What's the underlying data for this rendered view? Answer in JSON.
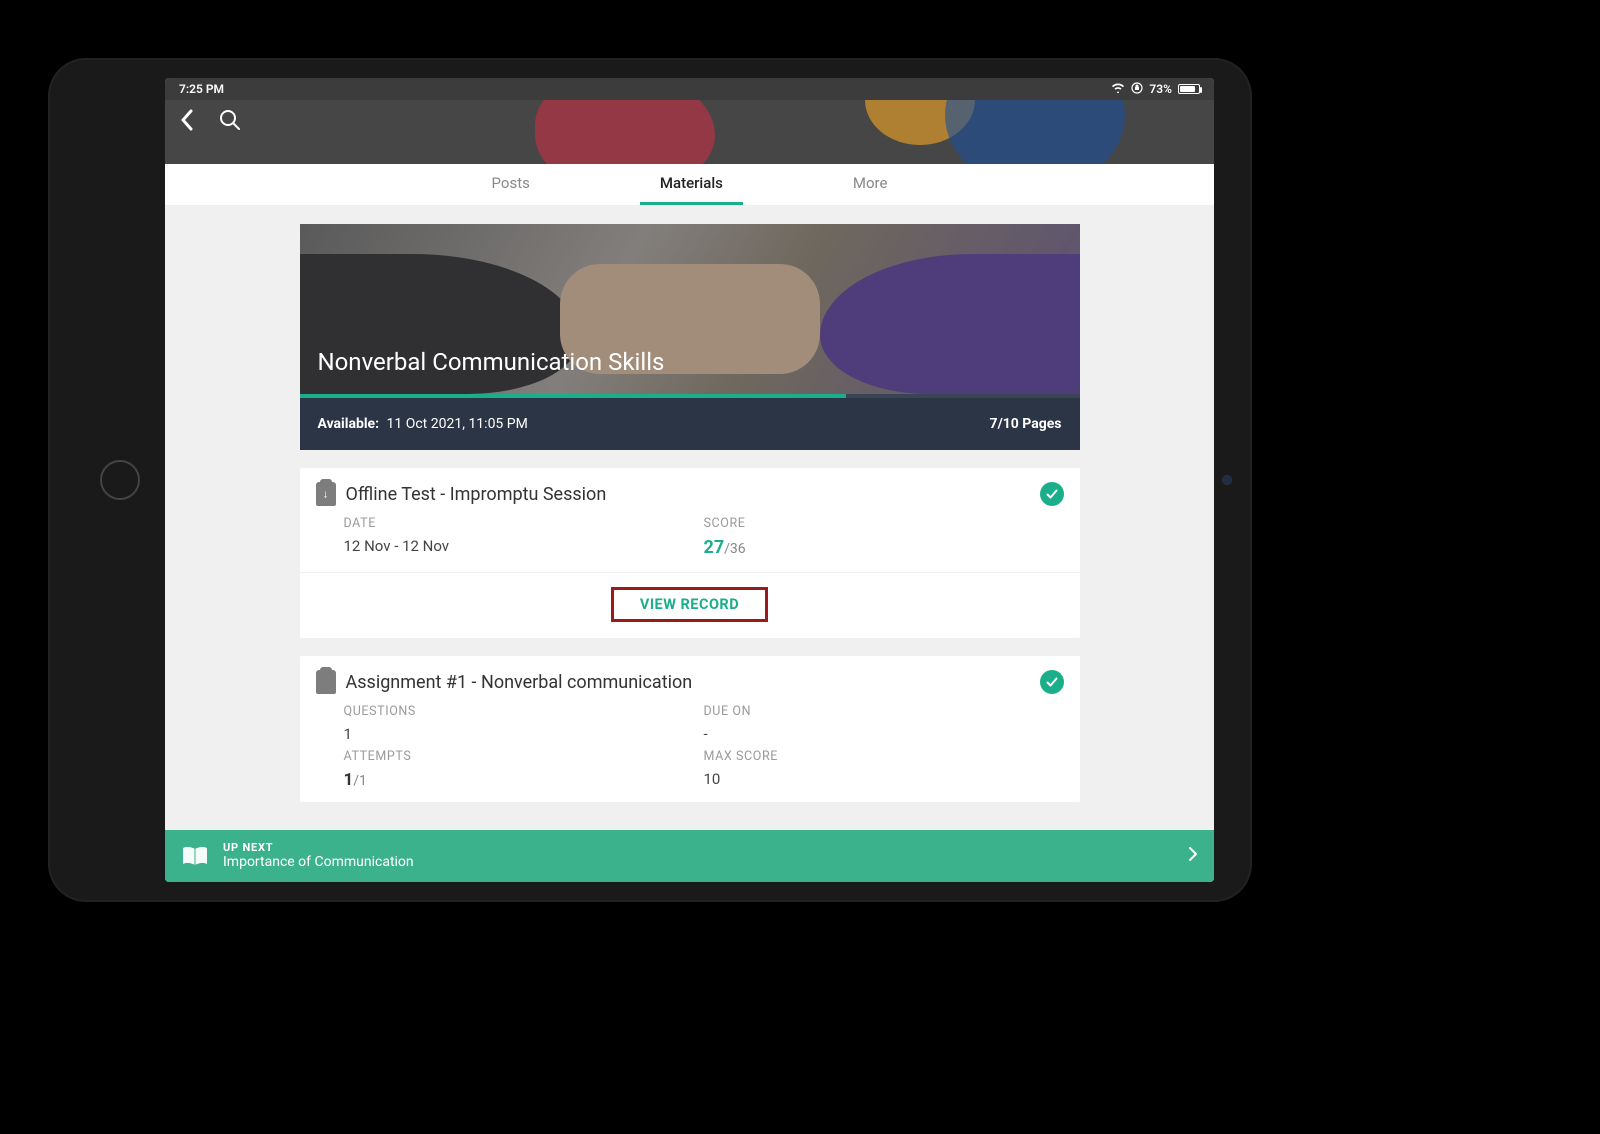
{
  "status": {
    "time": "7:25 PM",
    "batteryPercent": "73%"
  },
  "tabs": {
    "posts": "Posts",
    "materials": "Materials",
    "more": "More"
  },
  "hero": {
    "title": "Nonverbal Communication Skills",
    "availableLabel": "Available:",
    "availableValue": "11 Oct 2021, 11:05 PM",
    "pages": "7/10 Pages"
  },
  "card1": {
    "title": "Offline Test - Impromptu Session",
    "dateLabel": "DATE",
    "dateValue": "12 Nov - 12 Nov",
    "scoreLabel": "SCORE",
    "scoreEarned": "27",
    "scoreOf": "/36",
    "viewRecord": "VIEW RECORD"
  },
  "card2": {
    "title": "Assignment #1 - Nonverbal communication",
    "questionsLabel": "QUESTIONS",
    "questionsValue": "1",
    "dueLabel": "DUE ON",
    "dueValue": "-",
    "attemptsLabel": "ATTEMPTS",
    "attemptsDone": "1",
    "attemptsOf": "/1",
    "maxScoreLabel": "MAX SCORE",
    "maxScoreValue": "10"
  },
  "footer": {
    "upNext": "UP NEXT",
    "lesson": "Importance of Communication"
  }
}
